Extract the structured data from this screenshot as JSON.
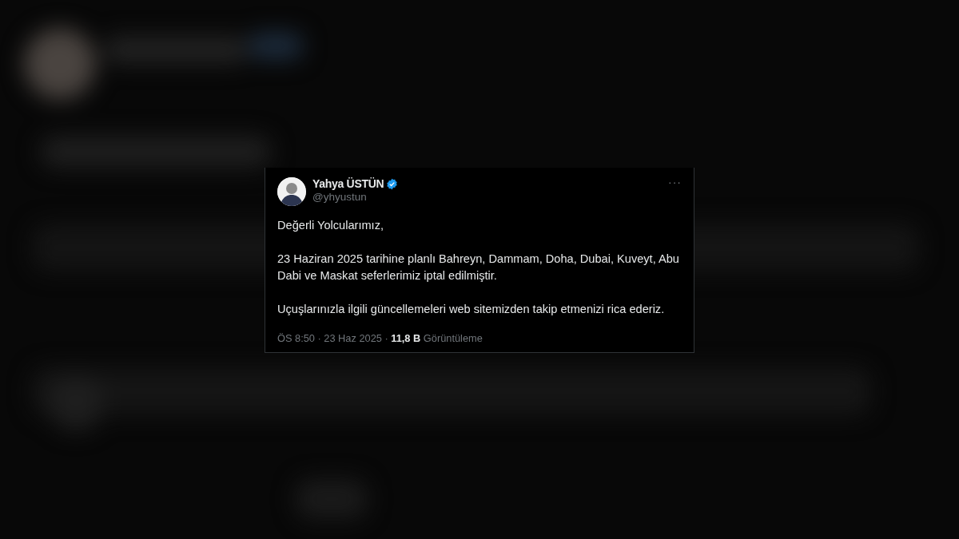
{
  "tweet": {
    "name": "Yahya ÜSTÜN",
    "verified": true,
    "handle": "@yhyustun",
    "more": "···",
    "paragraphs": [
      "Değerli Yolcularımız,",
      "23 Haziran 2025 tarihine planlı Bahreyn, Dammam, Doha, Dubai, Kuveyt, Abu Dabi ve Maskat seferlerimiz iptal edilmiştir.",
      "Uçuşlarınızla ilgili güncellemeleri web sitemizden takip etmenizi rica ederiz."
    ],
    "meta": "ÖS 8:50 · 23 Haz 2025 · **11,8 B** Görüntüleme"
  }
}
